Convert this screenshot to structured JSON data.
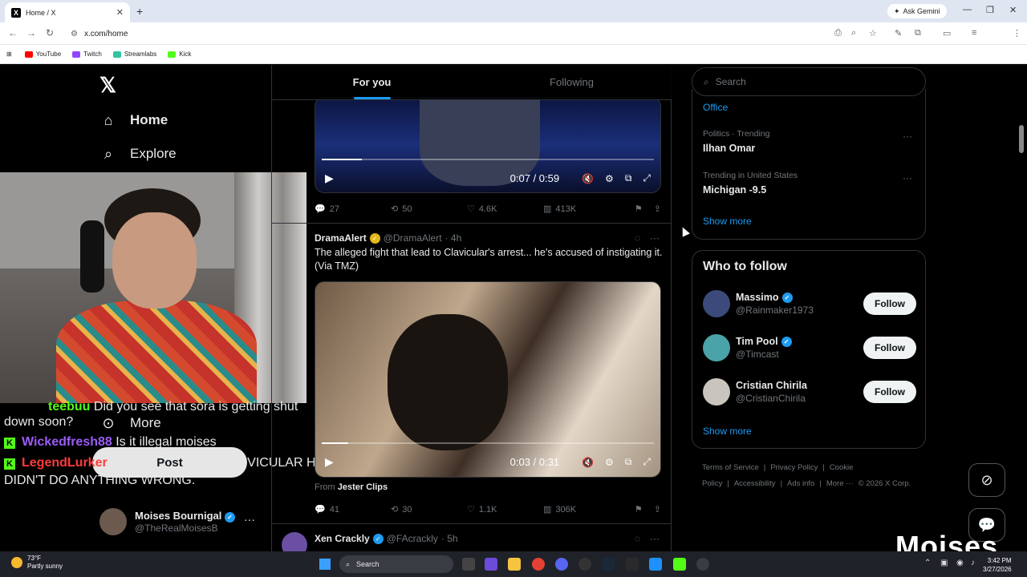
{
  "browser": {
    "tab_title": "Home / X",
    "tab_close": "✕",
    "new_tab": "+",
    "gemini_label": "Ask Gemini",
    "url": "x.com/home",
    "bookmarks": [
      {
        "label": "YouTube",
        "color": "#ff0000"
      },
      {
        "label": "Twitch",
        "color": "#9146ff"
      },
      {
        "label": "Streamlabs",
        "color": "#31c3a2"
      },
      {
        "label": "Kick",
        "color": "#53fc18"
      }
    ]
  },
  "nav": {
    "home": "Home",
    "explore": "Explore",
    "more": "More",
    "post": "Post"
  },
  "chat": {
    "line1_name": "teebuu",
    "line1_text": "Did you see that sora is getting shut",
    "line1_cont": "down soon?",
    "line2_name": "Wickedfresh88",
    "line2_text": "Is it illegal moises",
    "line3_name": "LegendLurker",
    "line3_text": "VICULAR HE",
    "line3_cont": "DIDN'T DO ANYTHING WRONG.",
    "kick_glyph": "K"
  },
  "profile": {
    "name": "Moises Bournigal",
    "handle": "@TheRealMoisesB"
  },
  "feed": {
    "tabs": [
      "For you",
      "Following"
    ],
    "video1": {
      "time": "0:07 / 0:59",
      "progress": 0.12,
      "replies": "27",
      "reposts": "50",
      "likes": "4.6K",
      "views": "413K"
    },
    "tweet2": {
      "name": "DramaAlert",
      "handle": "@DramaAlert",
      "age": "· 4h",
      "text": "The alleged fight that lead to Clavicular's arrest... he's accused of instigating it. (Via TMZ)",
      "video_time": "0:03 / 0:31",
      "progress": 0.08,
      "from_label": "From",
      "from_source": "Jester Clips",
      "replies": "41",
      "reposts": "30",
      "likes": "1.1K",
      "views": "306K"
    },
    "tweet3": {
      "name": "Xen Crackly",
      "handle": "@FAcrackly",
      "age": "· 5h"
    }
  },
  "sidebar": {
    "search_placeholder": "Search",
    "partial_trend": "Office",
    "trends": [
      {
        "category": "Politics · Trending",
        "title": "Ilhan Omar"
      },
      {
        "category": "Trending in United States",
        "title": "Michigan -9.5"
      }
    ],
    "show_more": "Show more",
    "who_to_follow": "Who to follow",
    "follow_label": "Follow",
    "suggestions": [
      {
        "name": "Massimo",
        "handle": "@Rainmaker1973",
        "color": "#3b4a7a"
      },
      {
        "name": "Tim Pool",
        "handle": "@Timcast",
        "color": "#4aa3a8"
      },
      {
        "name": "Cristian Chirila",
        "handle": "@CristianChirila",
        "color": "#c9c4bd"
      }
    ],
    "footer": [
      "Terms of Service",
      "|",
      "Privacy Policy",
      "|",
      "Cookie Policy",
      "|",
      "Accessibility",
      "|",
      "Ads info",
      "|",
      "More ···",
      "© 2026 X Corp."
    ]
  },
  "overlay": {
    "watermark": "Moises"
  },
  "taskbar": {
    "temp": "73°F",
    "weather": "Partly sunny",
    "search": "Search",
    "time": "3:42 PM",
    "date": "3/27/2026"
  }
}
